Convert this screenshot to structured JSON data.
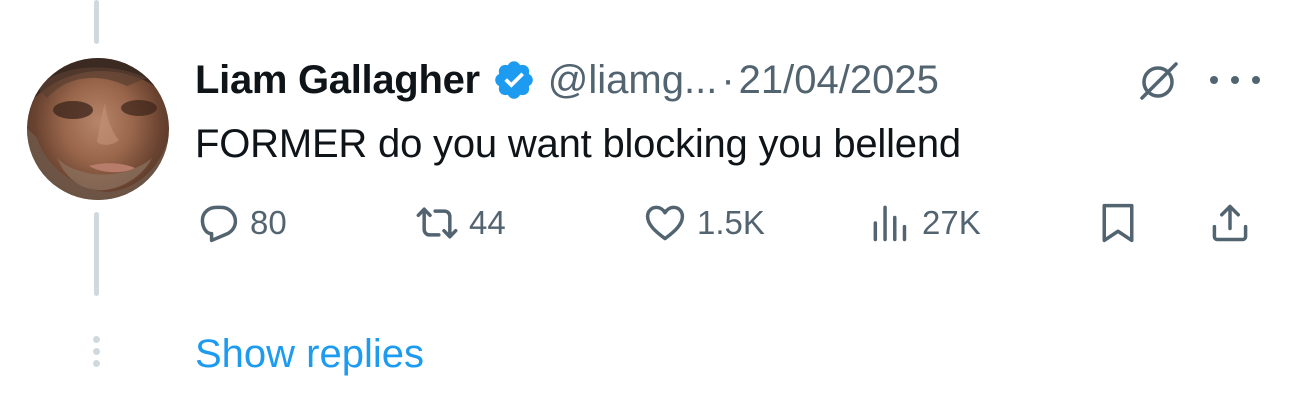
{
  "tweet": {
    "author_name": "Liam Gallagher",
    "handle": "@liamg...",
    "separator": "·",
    "date": "21/04/2025",
    "text": "FORMER do you want blocking you bellend",
    "verified": true
  },
  "actions": {
    "replies": "80",
    "reposts": "44",
    "likes": "1.5K",
    "views": "27K"
  },
  "show_replies_label": "Show replies",
  "icons": {
    "avatar": "avatar",
    "verified": "verified-badge-icon",
    "grok": "grok-icon",
    "more": "more-icon",
    "reply": "reply-icon",
    "repost": "repost-icon",
    "like": "heart-icon",
    "views": "views-icon",
    "bookmark": "bookmark-icon",
    "share": "share-icon"
  },
  "colors": {
    "text": "#0f1419",
    "secondary": "#536471",
    "accent": "#1d9bf0",
    "thread": "#cfd9de"
  }
}
